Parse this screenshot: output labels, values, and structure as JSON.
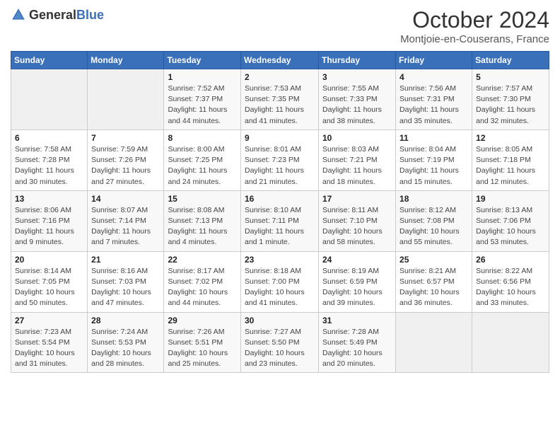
{
  "header": {
    "logo_general": "General",
    "logo_blue": "Blue",
    "month": "October 2024",
    "location": "Montjoie-en-Couserans, France"
  },
  "weekdays": [
    "Sunday",
    "Monday",
    "Tuesday",
    "Wednesday",
    "Thursday",
    "Friday",
    "Saturday"
  ],
  "weeks": [
    [
      {
        "day": "",
        "sunrise": "",
        "sunset": "",
        "daylight": ""
      },
      {
        "day": "",
        "sunrise": "",
        "sunset": "",
        "daylight": ""
      },
      {
        "day": "1",
        "sunrise": "Sunrise: 7:52 AM",
        "sunset": "Sunset: 7:37 PM",
        "daylight": "Daylight: 11 hours and 44 minutes."
      },
      {
        "day": "2",
        "sunrise": "Sunrise: 7:53 AM",
        "sunset": "Sunset: 7:35 PM",
        "daylight": "Daylight: 11 hours and 41 minutes."
      },
      {
        "day": "3",
        "sunrise": "Sunrise: 7:55 AM",
        "sunset": "Sunset: 7:33 PM",
        "daylight": "Daylight: 11 hours and 38 minutes."
      },
      {
        "day": "4",
        "sunrise": "Sunrise: 7:56 AM",
        "sunset": "Sunset: 7:31 PM",
        "daylight": "Daylight: 11 hours and 35 minutes."
      },
      {
        "day": "5",
        "sunrise": "Sunrise: 7:57 AM",
        "sunset": "Sunset: 7:30 PM",
        "daylight": "Daylight: 11 hours and 32 minutes."
      }
    ],
    [
      {
        "day": "6",
        "sunrise": "Sunrise: 7:58 AM",
        "sunset": "Sunset: 7:28 PM",
        "daylight": "Daylight: 11 hours and 30 minutes."
      },
      {
        "day": "7",
        "sunrise": "Sunrise: 7:59 AM",
        "sunset": "Sunset: 7:26 PM",
        "daylight": "Daylight: 11 hours and 27 minutes."
      },
      {
        "day": "8",
        "sunrise": "Sunrise: 8:00 AM",
        "sunset": "Sunset: 7:25 PM",
        "daylight": "Daylight: 11 hours and 24 minutes."
      },
      {
        "day": "9",
        "sunrise": "Sunrise: 8:01 AM",
        "sunset": "Sunset: 7:23 PM",
        "daylight": "Daylight: 11 hours and 21 minutes."
      },
      {
        "day": "10",
        "sunrise": "Sunrise: 8:03 AM",
        "sunset": "Sunset: 7:21 PM",
        "daylight": "Daylight: 11 hours and 18 minutes."
      },
      {
        "day": "11",
        "sunrise": "Sunrise: 8:04 AM",
        "sunset": "Sunset: 7:19 PM",
        "daylight": "Daylight: 11 hours and 15 minutes."
      },
      {
        "day": "12",
        "sunrise": "Sunrise: 8:05 AM",
        "sunset": "Sunset: 7:18 PM",
        "daylight": "Daylight: 11 hours and 12 minutes."
      }
    ],
    [
      {
        "day": "13",
        "sunrise": "Sunrise: 8:06 AM",
        "sunset": "Sunset: 7:16 PM",
        "daylight": "Daylight: 11 hours and 9 minutes."
      },
      {
        "day": "14",
        "sunrise": "Sunrise: 8:07 AM",
        "sunset": "Sunset: 7:14 PM",
        "daylight": "Daylight: 11 hours and 7 minutes."
      },
      {
        "day": "15",
        "sunrise": "Sunrise: 8:08 AM",
        "sunset": "Sunset: 7:13 PM",
        "daylight": "Daylight: 11 hours and 4 minutes."
      },
      {
        "day": "16",
        "sunrise": "Sunrise: 8:10 AM",
        "sunset": "Sunset: 7:11 PM",
        "daylight": "Daylight: 11 hours and 1 minute."
      },
      {
        "day": "17",
        "sunrise": "Sunrise: 8:11 AM",
        "sunset": "Sunset: 7:10 PM",
        "daylight": "Daylight: 10 hours and 58 minutes."
      },
      {
        "day": "18",
        "sunrise": "Sunrise: 8:12 AM",
        "sunset": "Sunset: 7:08 PM",
        "daylight": "Daylight: 10 hours and 55 minutes."
      },
      {
        "day": "19",
        "sunrise": "Sunrise: 8:13 AM",
        "sunset": "Sunset: 7:06 PM",
        "daylight": "Daylight: 10 hours and 53 minutes."
      }
    ],
    [
      {
        "day": "20",
        "sunrise": "Sunrise: 8:14 AM",
        "sunset": "Sunset: 7:05 PM",
        "daylight": "Daylight: 10 hours and 50 minutes."
      },
      {
        "day": "21",
        "sunrise": "Sunrise: 8:16 AM",
        "sunset": "Sunset: 7:03 PM",
        "daylight": "Daylight: 10 hours and 47 minutes."
      },
      {
        "day": "22",
        "sunrise": "Sunrise: 8:17 AM",
        "sunset": "Sunset: 7:02 PM",
        "daylight": "Daylight: 10 hours and 44 minutes."
      },
      {
        "day": "23",
        "sunrise": "Sunrise: 8:18 AM",
        "sunset": "Sunset: 7:00 PM",
        "daylight": "Daylight: 10 hours and 41 minutes."
      },
      {
        "day": "24",
        "sunrise": "Sunrise: 8:19 AM",
        "sunset": "Sunset: 6:59 PM",
        "daylight": "Daylight: 10 hours and 39 minutes."
      },
      {
        "day": "25",
        "sunrise": "Sunrise: 8:21 AM",
        "sunset": "Sunset: 6:57 PM",
        "daylight": "Daylight: 10 hours and 36 minutes."
      },
      {
        "day": "26",
        "sunrise": "Sunrise: 8:22 AM",
        "sunset": "Sunset: 6:56 PM",
        "daylight": "Daylight: 10 hours and 33 minutes."
      }
    ],
    [
      {
        "day": "27",
        "sunrise": "Sunrise: 7:23 AM",
        "sunset": "Sunset: 5:54 PM",
        "daylight": "Daylight: 10 hours and 31 minutes."
      },
      {
        "day": "28",
        "sunrise": "Sunrise: 7:24 AM",
        "sunset": "Sunset: 5:53 PM",
        "daylight": "Daylight: 10 hours and 28 minutes."
      },
      {
        "day": "29",
        "sunrise": "Sunrise: 7:26 AM",
        "sunset": "Sunset: 5:51 PM",
        "daylight": "Daylight: 10 hours and 25 minutes."
      },
      {
        "day": "30",
        "sunrise": "Sunrise: 7:27 AM",
        "sunset": "Sunset: 5:50 PM",
        "daylight": "Daylight: 10 hours and 23 minutes."
      },
      {
        "day": "31",
        "sunrise": "Sunrise: 7:28 AM",
        "sunset": "Sunset: 5:49 PM",
        "daylight": "Daylight: 10 hours and 20 minutes."
      },
      {
        "day": "",
        "sunrise": "",
        "sunset": "",
        "daylight": ""
      },
      {
        "day": "",
        "sunrise": "",
        "sunset": "",
        "daylight": ""
      }
    ]
  ]
}
